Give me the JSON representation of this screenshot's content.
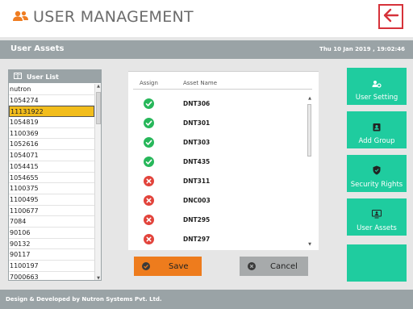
{
  "header": {
    "title": "USER MANAGEMENT",
    "icon": "users-icon",
    "back_icon": "arrow-left-icon",
    "accent": "#ef7d22"
  },
  "subbar": {
    "title": "User Assets",
    "datetime": "Thu 10 Jan 2019 , 19:02:46"
  },
  "user_list": {
    "header": "User List",
    "items": [
      "nutron",
      "1054274",
      "11131922",
      "1054819",
      "1100369",
      "1052616",
      "1054071",
      "1054415",
      "1054655",
      "1100375",
      "1100495",
      "1100677",
      "7084",
      "90106",
      "90132",
      "90117",
      "1100197",
      "7000663"
    ],
    "selected": "11131922"
  },
  "assets": {
    "columns": [
      "Assign",
      "Asset Name"
    ],
    "rows": [
      {
        "name": "DNT306",
        "assigned": true
      },
      {
        "name": "DNT301",
        "assigned": true
      },
      {
        "name": "DNT303",
        "assigned": true
      },
      {
        "name": "DNT435",
        "assigned": true
      },
      {
        "name": "DNT311",
        "assigned": false
      },
      {
        "name": "DNC003",
        "assigned": false
      },
      {
        "name": "DNT295",
        "assigned": false
      },
      {
        "name": "DNT297",
        "assigned": false
      }
    ]
  },
  "buttons": {
    "save": "Save",
    "cancel": "Cancel"
  },
  "side_menu": [
    {
      "label": "User Setting",
      "icon": "user-gear-icon"
    },
    {
      "label": "Add Group",
      "icon": "contact-card-icon"
    },
    {
      "label": "Security Rights",
      "icon": "shield-icon"
    },
    {
      "label": "User Assets",
      "icon": "monitor-user-icon"
    },
    {
      "label": "",
      "icon": ""
    }
  ],
  "footer": {
    "text": "Design & Developed by Nutron Systems Pvt. Ltd."
  }
}
